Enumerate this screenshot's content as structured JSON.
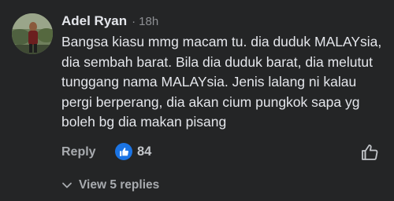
{
  "comment": {
    "author": "Adel Ryan",
    "separator": "·",
    "timestamp": "18h",
    "text_lines": [
      "Bangsa kiasu mmg macam tu. dia duduk MALAYsia,",
      "dia sembah barat. Bila dia duduk barat, dia melutut",
      "tunggang nama MALAYsia. Jenis lalang ni kalau",
      "pergi berperang, dia akan cium pungkok sapa yg",
      "boleh bg dia makan pisang"
    ],
    "actions": {
      "reply_label": "Reply",
      "reaction_icon": "thumbs-up-icon",
      "reaction_count": "84",
      "like_icon": "thumbs-up-outline-icon"
    },
    "replies": {
      "icon": "chevron-down-icon",
      "label": "View 5 replies"
    }
  },
  "colors": {
    "background": "#242526",
    "text_primary": "#e4e6eb",
    "text_secondary": "#a8abaf",
    "like_blue": "#1b74e4"
  }
}
